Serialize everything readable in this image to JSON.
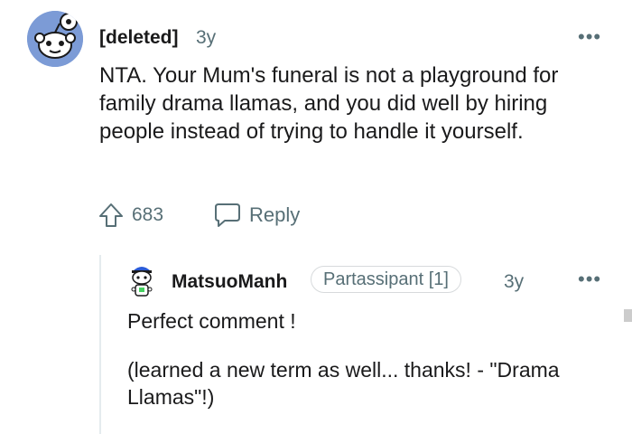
{
  "comment": {
    "author": "[deleted]",
    "age": "3y",
    "more_glyph": "•••",
    "body": "NTA. Your Mum's funeral is not a playground for family drama llamas, and you did well by hiring people instead of trying to handle it yourself.",
    "score": "683",
    "reply_label": "Reply",
    "avatar_icon": "snoo-avatar-icon",
    "upvote_icon": "upvote-arrow-icon",
    "reply_icon": "speech-bubble-icon"
  },
  "reply": {
    "author": "MatsuoManh",
    "flair": "Partassipant [1]",
    "age": "3y",
    "more_glyph": "•••",
    "line1": "Perfect comment !",
    "line2": "(learned a new term as well... thanks! - \"Drama Llamas\"!)"
  },
  "colors": {
    "text": "#1a1a1b",
    "muted": "#576f76",
    "avatar_bg": "#7c9bd6",
    "thread_line": "#e5ebee"
  }
}
